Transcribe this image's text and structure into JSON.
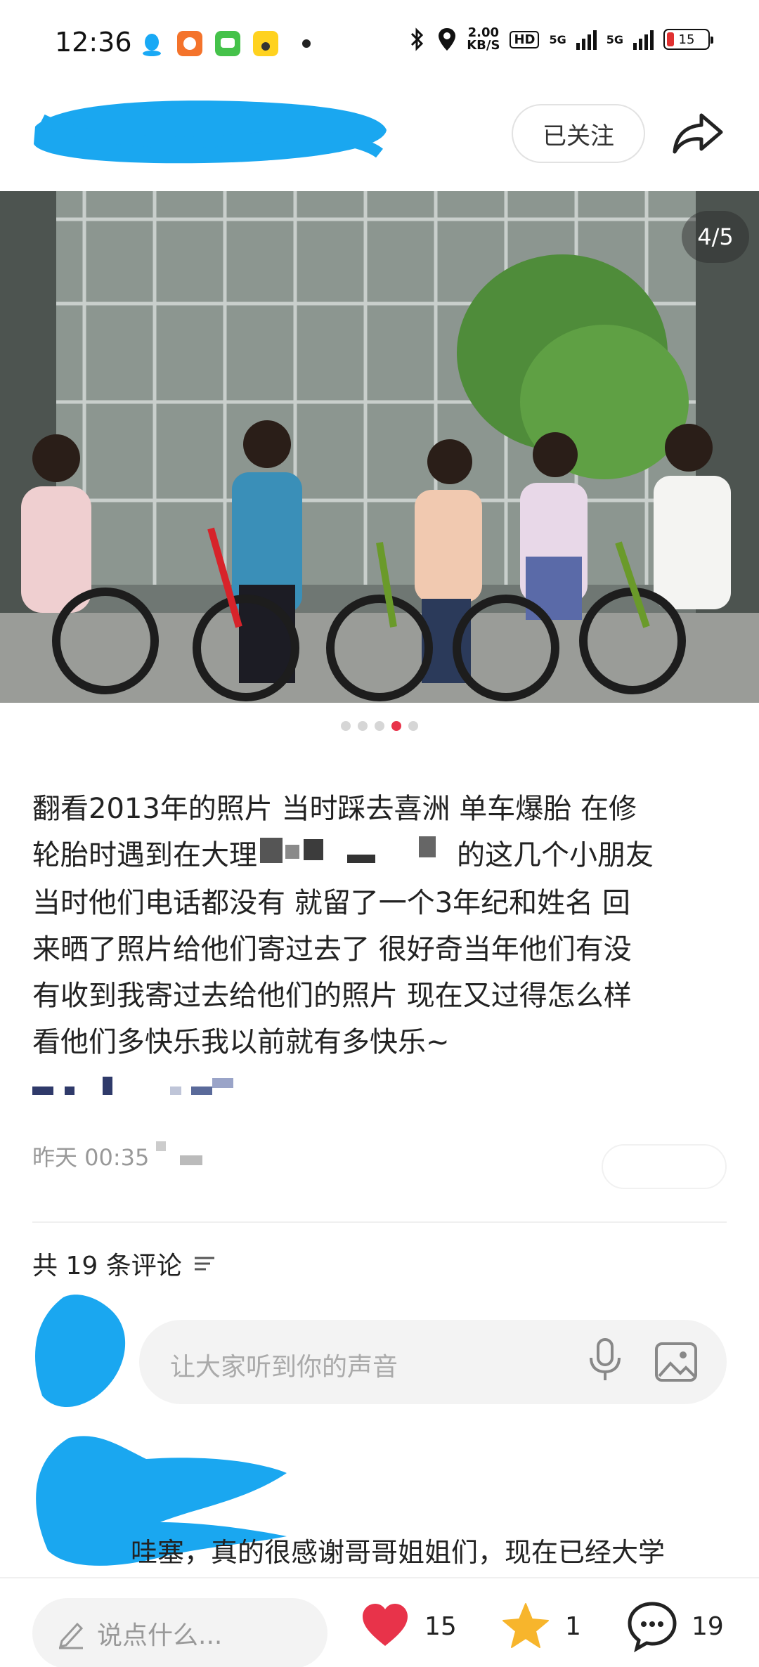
{
  "status_bar": {
    "time": "12:36",
    "net_speed_value": "2.00",
    "net_speed_unit": "KB/S",
    "hd_label": "HD",
    "sig1_label": "5G",
    "sig2_label": "5G",
    "battery": "15"
  },
  "header": {
    "follow_label": "已关注"
  },
  "photo": {
    "counter": "4/5",
    "total": 5,
    "current": 4
  },
  "post": {
    "line1": "翻看2013年的照片 当时踩去喜洲 单车爆胎 在修",
    "line2a": "轮胎时遇到在大理",
    "line2b": "的这几个小朋友",
    "line3": "当时他们电话都没有 就留了一个3年纪和姓名 回",
    "line4": "来晒了照片给他们寄过去了 很好奇当年他们有没",
    "line5": "有收到我寄过去给他们的照片 现在又过得怎么样",
    "line6": "看他们多快乐我以前就有多快乐~",
    "time": "昨天 00:35"
  },
  "comments": {
    "count_label": "共 19 条评论",
    "input_placeholder": "让大家听到你的声音",
    "first_comment": "哇塞，真的很感谢哥哥姐姐们，现在已经大学"
  },
  "bottom": {
    "say_placeholder": "说点什么...",
    "likes": "15",
    "stars": "1",
    "comments": "19"
  },
  "colors": {
    "accent": "#e8334a",
    "redact_blue": "#1aa7f0",
    "star": "#f7b52c"
  }
}
